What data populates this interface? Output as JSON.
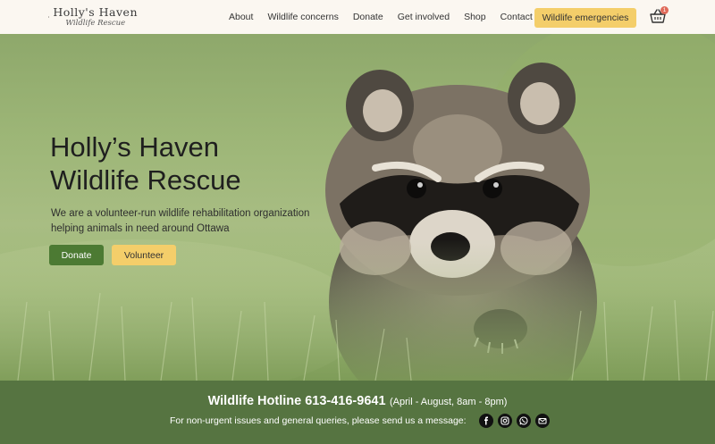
{
  "brand": {
    "name": "Holly's Haven",
    "tagline": "Wildlife Rescue"
  },
  "nav": {
    "items": [
      "About",
      "Wildlife concerns",
      "Donate",
      "Get involved",
      "Shop",
      "Contact us"
    ],
    "emergency_label": "Wildlife emergencies",
    "cart_count": "1"
  },
  "hero": {
    "title_line1": "Holly’s Haven",
    "title_line2": "Wildlife Rescue",
    "description": "We are a volunteer-run wildlife rehabilitation organization helping animals in need around Ottawa",
    "donate_label": "Donate",
    "volunteer_label": "Volunteer"
  },
  "footer": {
    "hotline": "Wildlife Hotline 613-416-9641",
    "hours": "(April - August, 8am - 8pm)",
    "message": "For non-urgent issues and general queries, please send us a message:",
    "social": [
      "facebook-icon",
      "instagram-icon",
      "whatsapp-icon",
      "email-icon"
    ]
  },
  "colors": {
    "primary_green": "#4c7a33",
    "accent_yellow": "#f4ce6a",
    "header_bg": "#fbf7f1",
    "footer_green": "#486832"
  }
}
